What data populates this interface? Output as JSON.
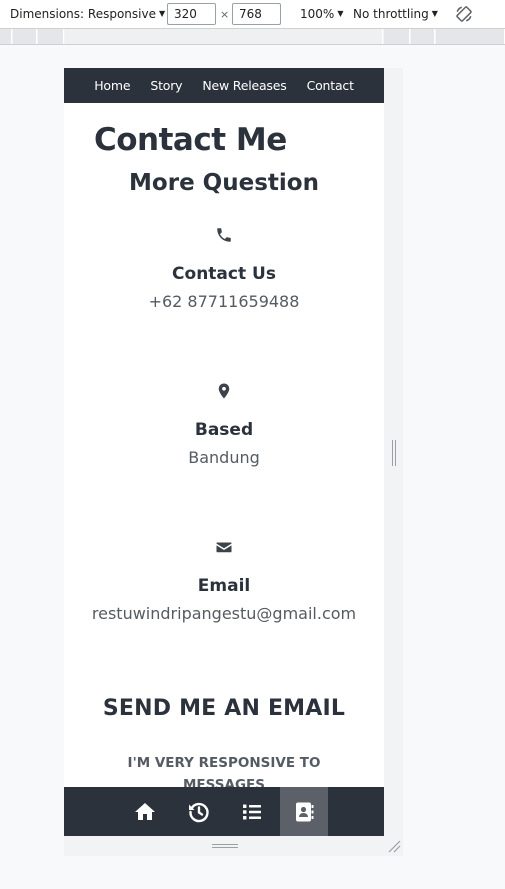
{
  "devtools": {
    "dimensions_label": "Dimensions: Responsive",
    "width_value": "320",
    "times": "×",
    "height_value": "768",
    "zoom": "100%",
    "throttling": "No throttling"
  },
  "site_nav": {
    "items": [
      "Home",
      "Story",
      "New Releases",
      "Contact"
    ]
  },
  "page": {
    "title": "Contact Me",
    "section_title": "More Question",
    "contact": {
      "label": "Contact Us",
      "value": "+62 87711659488",
      "icon": "phone-icon"
    },
    "based": {
      "label": "Based",
      "value": "Bandung",
      "icon": "map-marker-icon"
    },
    "email": {
      "label": "Email",
      "value": "restuwindripangestu@gmail.com",
      "icon": "envelope-icon"
    },
    "send_title": "SEND ME AN EMAIL",
    "send_subtitle": "I'M VERY RESPONSIVE TO MESSAGES"
  },
  "tabbar": {
    "tabs": [
      "home-icon",
      "history-icon",
      "list-icon",
      "contact-book-icon"
    ],
    "active_index": 3
  },
  "colors": {
    "nav_bg": "#2b323c",
    "text_dark": "#2b323c",
    "text_muted": "#555b63",
    "active_tab": "#5c6169"
  }
}
